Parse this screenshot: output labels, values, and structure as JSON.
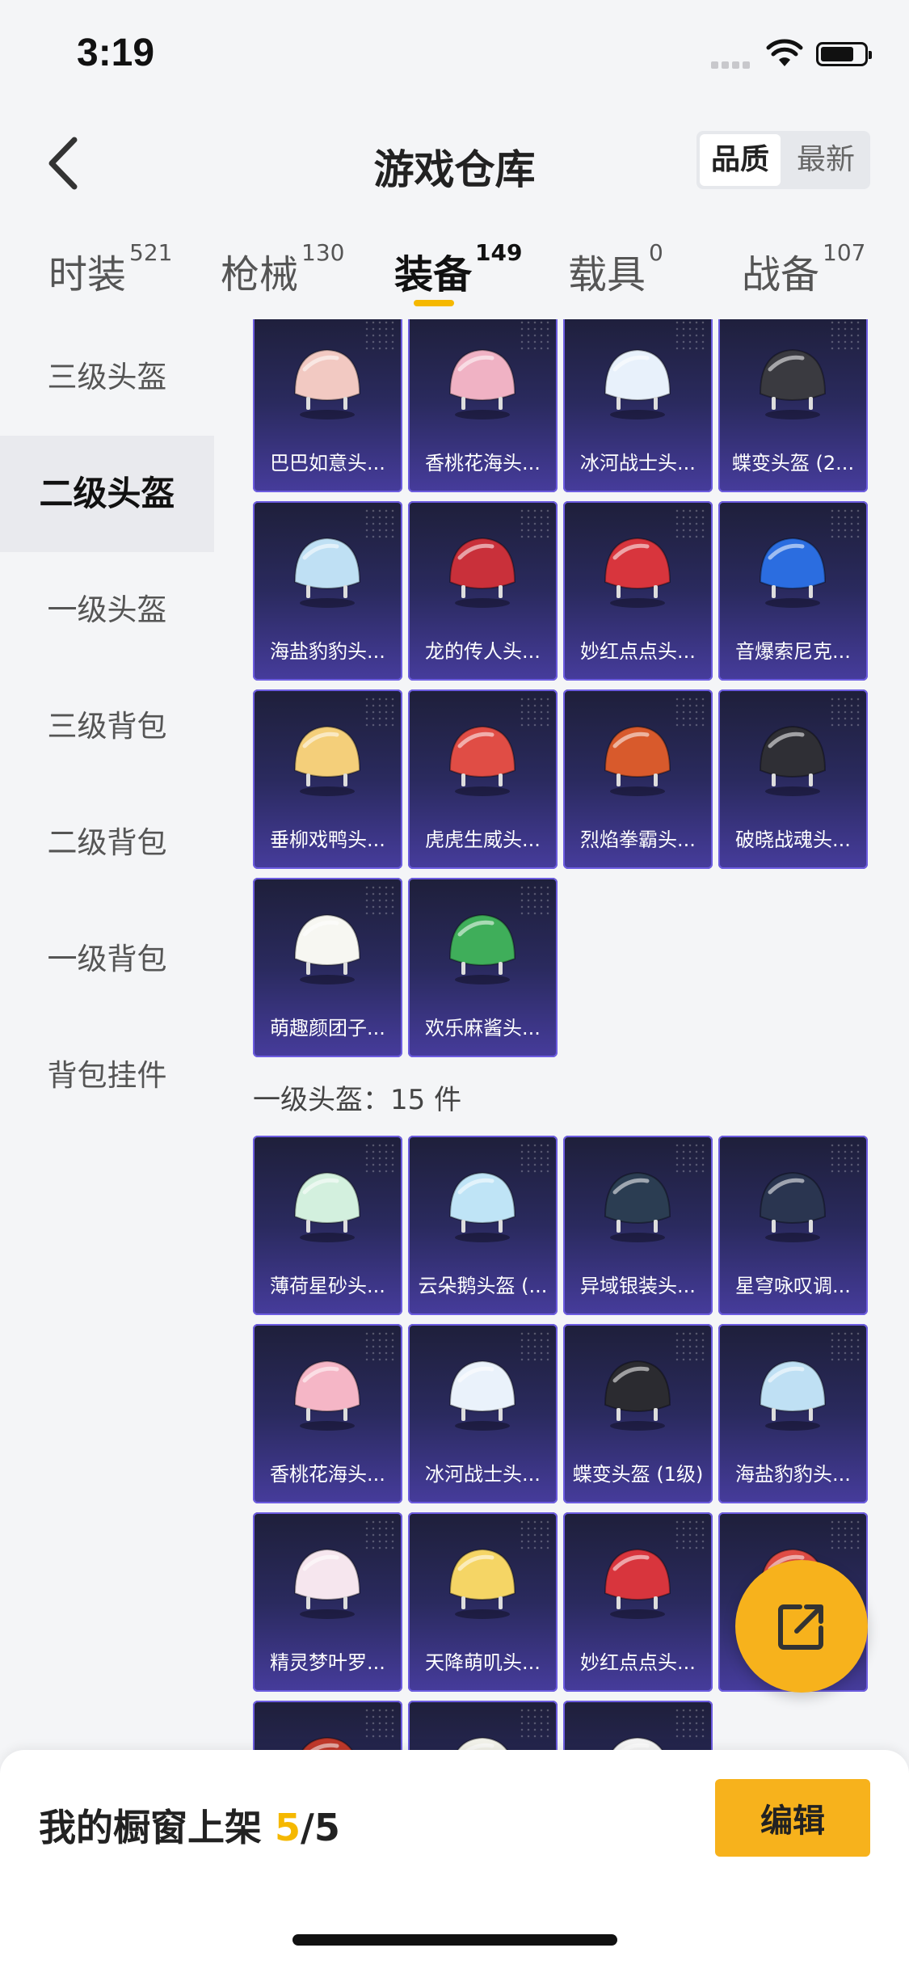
{
  "status": {
    "time": "3:19"
  },
  "header": {
    "title": "游戏仓库",
    "sort": {
      "active": "品质",
      "other": "最新"
    }
  },
  "tabs": [
    {
      "label": "时装",
      "count": "521"
    },
    {
      "label": "枪械",
      "count": "130"
    },
    {
      "label": "装备",
      "count": "149"
    },
    {
      "label": "载具",
      "count": "0"
    },
    {
      "label": "战备",
      "count": "107"
    }
  ],
  "sidebar": {
    "items": [
      {
        "label": "三级头盔"
      },
      {
        "label": "二级头盔"
      },
      {
        "label": "一级头盔"
      },
      {
        "label": "三级背包"
      },
      {
        "label": "二级背包"
      },
      {
        "label": "一级背包"
      },
      {
        "label": "背包挂件"
      }
    ]
  },
  "level2": {
    "items": [
      {
        "name": "巴巴如意头...",
        "color": "#f2c9c2"
      },
      {
        "name": "香桃花海头...",
        "color": "#f0b2c4"
      },
      {
        "name": "冰河战士头...",
        "color": "#e8f1fb"
      },
      {
        "name": "蝶变头盔 (2...",
        "color": "#3a3a40"
      },
      {
        "name": "海盐豹豹头...",
        "color": "#bfe0f4"
      },
      {
        "name": "龙的传人头...",
        "color": "#c9303a"
      },
      {
        "name": "妙红点点头...",
        "color": "#d8353d"
      },
      {
        "name": "音爆索尼克...",
        "color": "#2b6de0"
      },
      {
        "name": "垂柳戏鸭头...",
        "color": "#f4cf7a"
      },
      {
        "name": "虎虎生威头...",
        "color": "#e04d45"
      },
      {
        "name": "烈焰拳霸头...",
        "color": "#d85a2c"
      },
      {
        "name": "破晓战魂头...",
        "color": "#2f2f35"
      },
      {
        "name": "萌趣颜团子...",
        "color": "#f7f7f2"
      },
      {
        "name": "欢乐麻酱头...",
        "color": "#3fae5a"
      }
    ]
  },
  "level1": {
    "label": "一级头盔：15 件",
    "items": [
      {
        "name": "薄荷星砂头...",
        "color": "#d3f0de"
      },
      {
        "name": "云朵鹅头盔 (...",
        "color": "#bfe4f6"
      },
      {
        "name": "异域银装头...",
        "color": "#2b3d52"
      },
      {
        "name": "星穹咏叹调...",
        "color": "#2a3550"
      },
      {
        "name": "香桃花海头...",
        "color": "#f5b6c6"
      },
      {
        "name": "冰河战士头...",
        "color": "#eaf2fb"
      },
      {
        "name": "蝶变头盔 (1级)",
        "color": "#2b2b30"
      },
      {
        "name": "海盐豹豹头...",
        "color": "#bfe0f4"
      },
      {
        "name": "精灵梦叶罗...",
        "color": "#f6e6ee"
      },
      {
        "name": "天降萌叽头...",
        "color": "#f5d565"
      },
      {
        "name": "妙红点点头...",
        "color": "#d8353d"
      },
      {
        "name": "虎虎...",
        "color": "#e04d45"
      },
      {
        "name": "",
        "color": "#c0392b"
      },
      {
        "name": "",
        "color": "#f2f2ea"
      },
      {
        "name": "",
        "color": "#f4f4f4"
      }
    ]
  },
  "bottom": {
    "showcase_label": "我的橱窗上架",
    "count": "5",
    "total": "/5",
    "edit_label": "编辑"
  }
}
